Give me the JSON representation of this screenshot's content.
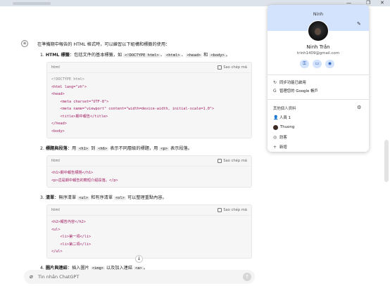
{
  "browser": {
    "window_controls": [
      "—",
      "❐",
      "✕"
    ]
  },
  "chat": {
    "intro": "在準備期中報告的 HTML 格式時，可以練習以下組構和標籤的使用：",
    "items": [
      {
        "number": "1.",
        "title": "HTML 標籤",
        "desc": "：包括文件的基本標籤，如",
        "codes": [
          "<!DOCTYPE html>",
          "<html>",
          "<head>",
          "<body>"
        ],
        "seps": [
          "、",
          "、",
          " 和 "
        ],
        "end": "。"
      },
      {
        "number": "2.",
        "title": "標題與段落",
        "parts": [
          "：用 ",
          " 到 ",
          " 表示不同層級的標題，用 ",
          " 表示段落。"
        ],
        "codes": [
          "<h1>",
          "<h6>",
          "<p>"
        ]
      },
      {
        "number": "3.",
        "title": "清單",
        "parts": [
          "：無序清單 ",
          " 和有序清單 ",
          " 可以整理重點內容。"
        ],
        "codes": [
          "<ul>",
          "<ol>"
        ]
      },
      {
        "number": "4.",
        "title": "圖片與連結",
        "parts": [
          "：插入圖片 ",
          " 以及加入連結 ",
          "。"
        ],
        "codes": [
          "<img>",
          "<a>"
        ]
      }
    ],
    "code_blocks": [
      {
        "lang": "html",
        "copy_label": "Sao chép mã",
        "lines": [
          "<!DOCTYPE html>",
          "<html lang=\"zh\">",
          "<head>",
          "    <meta charset=\"UTF-8\">",
          "    <meta name=\"viewport\" content=\"width=device-width, initial-scale=1.0\">",
          "    <title>期中報告</title>",
          "</head>",
          "<body>"
        ]
      },
      {
        "lang": "html",
        "copy_label": "Sao chép mã",
        "lines": [
          "<h1>期中報告標題</h1>",
          "<p>這是期中報告的簡短介紹段落。</p>"
        ]
      },
      {
        "lang": "html",
        "copy_label": "Sao chép mã",
        "lines": [
          "<h2>報告內容</h2>",
          "<ul>",
          "    <li>第一項</li>",
          "    <li>第二項</li>",
          "</ul>"
        ]
      }
    ],
    "scroll_down_icon": "↓",
    "composer": {
      "placeholder": "Tin nhắn ChatGPT",
      "attach_icon": "paperclip-icon",
      "send_icon": "arrow-up-icon"
    }
  },
  "profile": {
    "header_name": "Ninh",
    "name": "Ninh Trần",
    "email": "trinh1409@gmail.com",
    "quick_actions": [
      "password-key-icon",
      "payment-card-icon",
      "location-pin-icon"
    ],
    "menu": [
      {
        "icon": "sync-icon",
        "label": "同步功能已啟用"
      },
      {
        "icon": "google-icon",
        "label": "管理您的 Google 帳戶"
      }
    ],
    "other_profiles_label": "其他個人資料",
    "profiles": [
      {
        "label": "人員 1",
        "color": "#8a8a8a"
      },
      {
        "label": "Thuong",
        "color": "#3b2a22"
      },
      {
        "label": "訪客",
        "color": "#5f6368"
      },
      {
        "label": "新增",
        "color": "#5f6368"
      }
    ],
    "colors": {
      "header_bg": "#d3e3fd",
      "chip_bg": "#d3e3fd",
      "chip_fg": "#1a56b5"
    }
  }
}
